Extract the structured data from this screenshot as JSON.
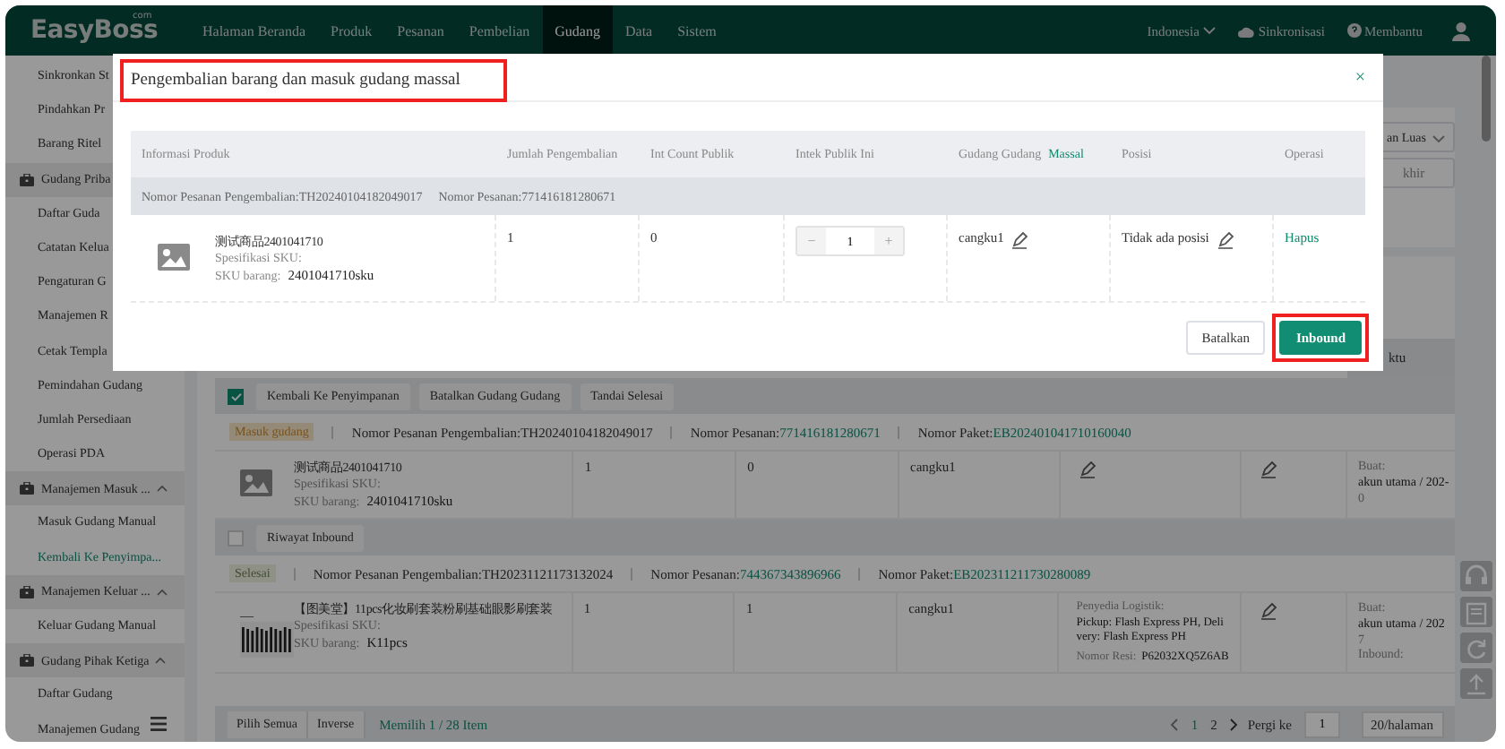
{
  "topbar": {
    "logo": "EasyBoss",
    "logo_suffix": "com",
    "nav": [
      {
        "label": "Halaman Beranda",
        "selected": false
      },
      {
        "label": "Produk",
        "selected": false
      },
      {
        "label": "Pesanan",
        "selected": false
      },
      {
        "label": "Pembelian",
        "selected": false
      },
      {
        "label": "Gudang",
        "selected": true
      },
      {
        "label": "Data",
        "selected": false
      },
      {
        "label": "Sistem",
        "selected": false
      }
    ],
    "language": "Indonesia",
    "sync": "Sinkronisasi",
    "help": "Membantu"
  },
  "sidebar": {
    "items": [
      {
        "kind": "item",
        "label": "Sinkronkan St",
        "selected": false
      },
      {
        "kind": "item",
        "label": "Pindahkan Pr",
        "selected": false
      },
      {
        "kind": "item",
        "label": "Barang Ritel",
        "selected": false
      },
      {
        "kind": "section",
        "label": "Gudang Priba",
        "children": [
          {
            "label": "Daftar Guda",
            "selected": false
          },
          {
            "label": "Catatan Kelua",
            "selected": false
          },
          {
            "label": "Pengaturan G",
            "selected": false
          },
          {
            "label": "Manajemen R",
            "selected": false
          },
          {
            "label": "Cetak Templa",
            "selected": false
          },
          {
            "label": "Pemindahan Gudang",
            "selected": false
          },
          {
            "label": "Jumlah Persediaan",
            "selected": false
          },
          {
            "label": "Operasi PDA",
            "selected": false
          }
        ]
      },
      {
        "kind": "section",
        "label": "Manajemen Masuk ...",
        "expanded": true,
        "children": [
          {
            "label": "Masuk Gudang Manual",
            "selected": false
          },
          {
            "label": "Kembali Ke Penyimpa...",
            "selected": true
          }
        ]
      },
      {
        "kind": "section",
        "label": "Manajemen Keluar ...",
        "expanded": true,
        "children": [
          {
            "label": "Keluar Gudang Manual",
            "selected": false
          }
        ]
      },
      {
        "kind": "section",
        "label": "Gudang Pihak Ketiga",
        "expanded": true,
        "children": [
          {
            "label": "Daftar Gudang",
            "selected": false
          },
          {
            "label": "Manajemen Gudang",
            "selected": false
          }
        ]
      }
    ]
  },
  "page": {
    "filter_dropdown": "an Luas",
    "filter_input": "khir",
    "tab_fragment": "ktu",
    "orders": [
      {
        "checked": true,
        "buttons": [
          "Kembali Ke Penyimpanan",
          "Batalkan Gudang Gudang",
          "Tandai Selesai"
        ],
        "kind": "receiving",
        "status": "Masuk gudang",
        "return_order": "Nomor Pesanan Pengembalian:TH20240104182049017",
        "order_label": "Nomor Pesanan:",
        "order": "771416181280671",
        "package_label": "Nomor Paket:",
        "package": "EB202401041710160040",
        "item": {
          "kind": "placeholder",
          "name": "测试商品2401041710",
          "spec": "Spesifikasi SKU:",
          "sku_label": "SKU barang:",
          "sku": "2401041710sku",
          "qty": "1",
          "count": "0",
          "warehouse": "cangku1",
          "info": [
            "Buat:",
            "akun utama / 202-",
            "0"
          ]
        }
      },
      {
        "checked": false,
        "buttons": [
          "Riwayat Inbound"
        ],
        "kind": "done",
        "status": "Selesai",
        "return_order": "Nomor Pesanan Pengembalian:TH20231121173132024",
        "order_label": "Nomor Pesanan:",
        "order": "744367343896966",
        "package_label": "Nomor Paket:",
        "package": "EB202311211730280089",
        "item": {
          "kind": "picture",
          "dash": "—",
          "name": "【图美堂】11pcs化妆刷套装粉刷基础眼影刷套装",
          "spec": "Spesifikasi SKU:",
          "sku_label": "SKU barang:",
          "sku": "K11pcs",
          "qty": "1",
          "count": "1",
          "warehouse": "cangku1",
          "logistics": {
            "label": "Penyedia Logistik:",
            "value": "Pickup: Flash Express PH, Delivery: Flash Express PH",
            "resi_label": "Nomor Resi:",
            "resi": "P62032XQ5Z6AB"
          },
          "info": [
            "Buat:",
            "akun utama / 202",
            "7",
            "Inbound:"
          ]
        }
      }
    ],
    "footer": {
      "select_all": "Pilih Semua",
      "inverse": "Inverse",
      "selection": "Memilih 1 / 28 Item",
      "pages": [
        {
          "label": "1",
          "selected": true
        },
        {
          "label": "2",
          "selected": false
        }
      ],
      "goto_label": "Pergi ke",
      "goto_value": "1",
      "page_size": "20/halaman"
    }
  },
  "modal": {
    "title": "Pengembalian barang dan masuk gudang massal",
    "title_highlighted": true,
    "close": "×",
    "columns": [
      {
        "label": "Informasi Produk"
      },
      {
        "label": "Jumlah Pengembalian"
      },
      {
        "label": "Int Count Publik"
      },
      {
        "label": "Intek Publik Ini"
      },
      {
        "label": "Gudang Gudang",
        "link": "Massal"
      },
      {
        "label": "Posisi"
      },
      {
        "label": "Operasi"
      }
    ],
    "groups": [
      {
        "return_order": "Nomor Pesanan Pengembalian:TH20240104182049017",
        "order": "Nomor Pesanan:771416181280671",
        "rows": [
          {
            "name": "测试商品2401041710",
            "spec": "Spesifikasi SKU:",
            "sku_label": "SKU barang:",
            "sku": "2401041710sku",
            "qty": "1",
            "count": "0",
            "decrement": "−",
            "intake": "1",
            "increment": "+",
            "warehouse": "cangku1",
            "position": "Tidak ada posisi",
            "action": "Hapus"
          }
        ]
      }
    ],
    "buttons": [
      {
        "label": "Batalkan",
        "kind": "secondary",
        "highlighted": false
      },
      {
        "label": "Inbound",
        "kind": "primary",
        "highlighted": true
      }
    ]
  }
}
